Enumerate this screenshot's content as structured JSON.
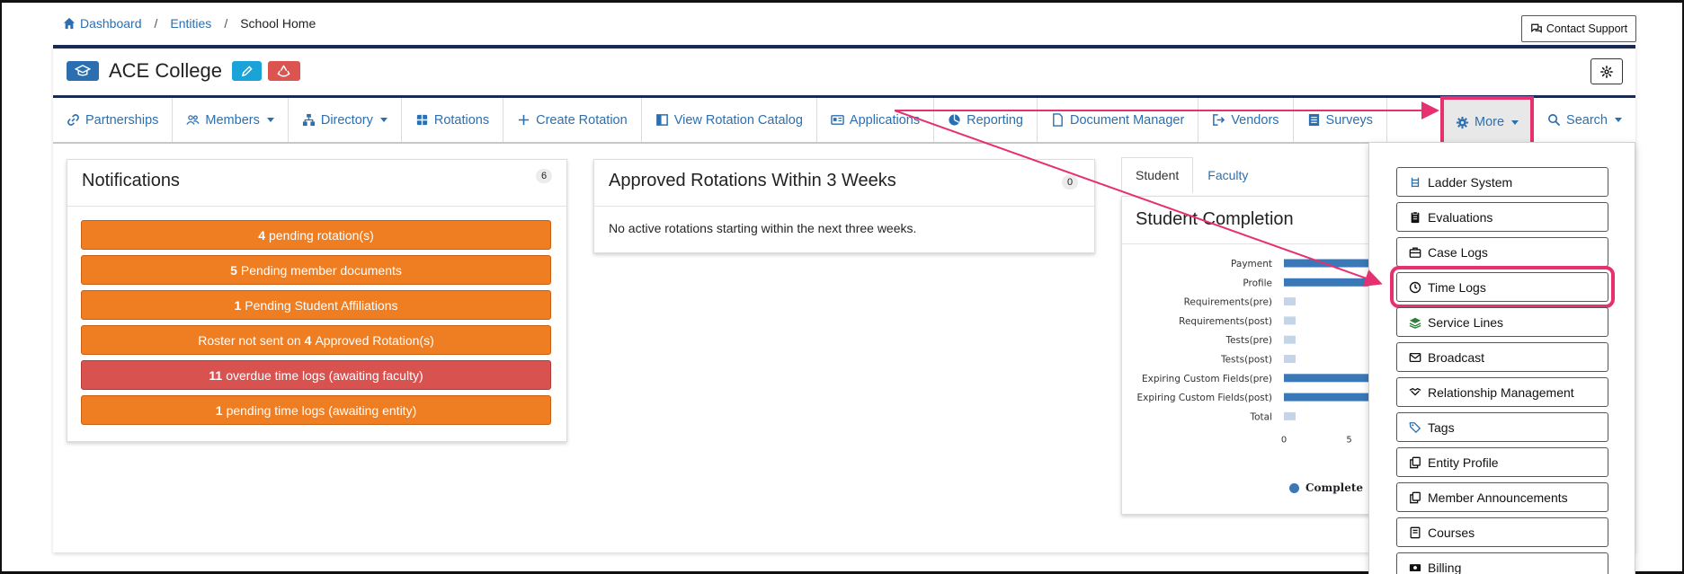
{
  "breadcrumb": {
    "items": [
      "Dashboard",
      "Entities"
    ],
    "current": "School Home",
    "separator": "/"
  },
  "contact_support": "Contact Support",
  "entity": {
    "name": "ACE College"
  },
  "nav": {
    "items": [
      {
        "label": "Partnerships",
        "icon": "link-icon",
        "caret": false
      },
      {
        "label": "Members",
        "icon": "users-icon",
        "caret": true
      },
      {
        "label": "Directory",
        "icon": "sitemap-icon",
        "caret": true
      },
      {
        "label": "Rotations",
        "icon": "grid-icon",
        "caret": false
      },
      {
        "label": "Create Rotation",
        "icon": "plus-icon",
        "caret": false
      },
      {
        "label": "View Rotation Catalog",
        "icon": "book-icon",
        "caret": false
      },
      {
        "label": "Applications",
        "icon": "id-card-icon",
        "caret": false
      },
      {
        "label": "Reporting",
        "icon": "chart-icon",
        "caret": false
      },
      {
        "label": "Document Manager",
        "icon": "file-icon",
        "caret": false
      },
      {
        "label": "Vendors",
        "icon": "sign-out-icon",
        "caret": false
      },
      {
        "label": "Surveys",
        "icon": "list-icon",
        "caret": false
      }
    ],
    "more": "More",
    "search": "Search"
  },
  "notifications": {
    "title": "Notifications",
    "count": "6",
    "items": [
      {
        "bold": "4",
        "text": "pending rotation(s)",
        "color": "#ef7d22"
      },
      {
        "bold": "5",
        "text": "Pending member documents",
        "color": "#ef7d22"
      },
      {
        "bold": "1",
        "text": "Pending Student Affiliations",
        "color": "#ef7d22"
      },
      {
        "prefix": "Roster not sent on",
        "bold": "4",
        "text": "Approved Rotation(s)",
        "color": "#ef7d22"
      },
      {
        "bold": "11",
        "text": "overdue time logs (awaiting faculty)",
        "color": "#d8534f"
      },
      {
        "bold": "1",
        "text": "pending time logs (awaiting entity)",
        "color": "#ef7d22"
      }
    ]
  },
  "approved": {
    "title": "Approved Rotations Within 3 Weeks",
    "count": "0",
    "message": "No active rotations starting within the next three weeks."
  },
  "tabs": [
    {
      "label": "Student",
      "active": true
    },
    {
      "label": "Faculty",
      "active": false
    }
  ],
  "completion": {
    "title": "Student Completion",
    "legend_complete": "Complete"
  },
  "chart_data": {
    "type": "bar",
    "orientation": "horizontal",
    "title": "Student Completion",
    "categories": [
      "Payment",
      "Profile",
      "Requirements(pre)",
      "Requirements(post)",
      "Tests(pre)",
      "Tests(post)",
      "Expiring Custom Fields(pre)",
      "Expiring Custom Fields(post)",
      "Total"
    ],
    "x_ticks": [
      "0",
      "5"
    ],
    "series": [
      {
        "name": "Complete",
        "color": "#3a78b8",
        "values": [
          null,
          null,
          0,
          0,
          0,
          0,
          null,
          null,
          0
        ]
      }
    ],
    "note_visible": "Bars for Payment, Profile and Expiring Custom Fields extend beyond the visible area behind the dropdown"
  },
  "dropdown": {
    "items": [
      {
        "label": "Ladder System",
        "icon": "ladder-icon",
        "highlight": false
      },
      {
        "label": "Evaluations",
        "icon": "clipboard-icon",
        "highlight": false
      },
      {
        "label": "Case Logs",
        "icon": "briefcase-icon",
        "highlight": false
      },
      {
        "label": "Time Logs",
        "icon": "clock-icon",
        "highlight": true
      },
      {
        "label": "Service Lines",
        "icon": "layers-icon",
        "highlight": false
      },
      {
        "label": "Broadcast",
        "icon": "envelope-icon",
        "highlight": false
      },
      {
        "label": "Relationship Management",
        "icon": "handshake-icon",
        "highlight": false
      },
      {
        "label": "Tags",
        "icon": "tags-icon",
        "highlight": false
      },
      {
        "label": "Entity Profile",
        "icon": "copy-icon",
        "highlight": false
      },
      {
        "label": "Member Announcements",
        "icon": "copy-icon",
        "highlight": false
      },
      {
        "label": "Courses",
        "icon": "book-icon",
        "highlight": false
      },
      {
        "label": "Billing",
        "icon": "money-icon",
        "highlight": false
      }
    ]
  },
  "colors": {
    "navy": "#1b2a55",
    "link": "#2c6fb0",
    "orange": "#ef7d22",
    "red": "#d8534f",
    "annotation": "#e6306f"
  }
}
